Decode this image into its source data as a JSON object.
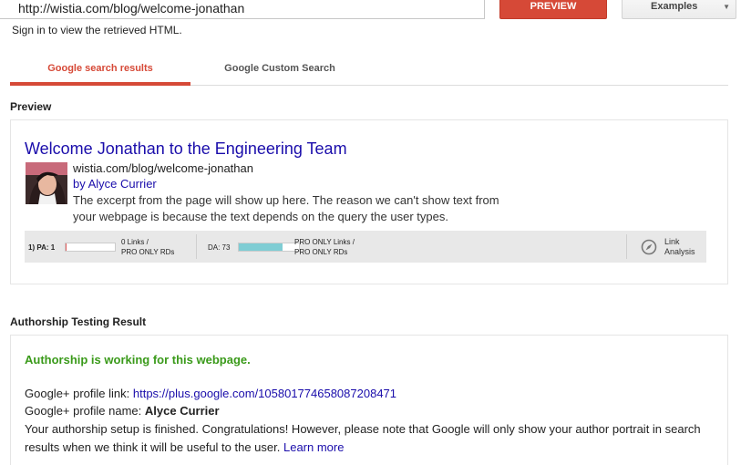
{
  "toolbar": {
    "url_value": "http://wistia.com/blog/welcome-jonathan",
    "preview_label": "PREVIEW",
    "examples_label": "Examples",
    "examples_caret": "▼"
  },
  "signin_note": "Sign in to view the retrieved HTML.",
  "tabs": [
    {
      "label": "Google search results",
      "active": true
    },
    {
      "label": "Google Custom Search",
      "active": false
    }
  ],
  "preview": {
    "heading": "Preview",
    "title": "Welcome Jonathan to the Engineering Team",
    "url": "wistia.com/blog/welcome-jonathan",
    "author": "by Alyce Currier",
    "snippet_line1": "The excerpt from the page will show up here. The reason we can't show text from",
    "snippet_line2": "your webpage is because the text depends on the query the user types."
  },
  "metrics": {
    "rank_pa": "1) PA: 1",
    "pa_fill_fraction": 0.02,
    "links_line1": "0 Links /",
    "links_line2": "PRO ONLY RDs",
    "da": "DA: 73",
    "da_fill_fraction": 0.73,
    "pro_links_line1": "PRO ONLY Links /",
    "pro_links_line2": "PRO ONLY RDs",
    "link_analysis_line1": "Link",
    "link_analysis_line2": "Analysis"
  },
  "authorship": {
    "heading": "Authorship Testing Result",
    "status": "Authorship is working for this webpage.",
    "profile_link_label": "Google+ profile link: ",
    "profile_link_url": "https://plus.google.com/105801774658087208471",
    "profile_name_label": "Google+ profile name: ",
    "profile_name": "Alyce Currier",
    "message": "Your authorship setup is finished. Congratulations! However, please note that Google will only show your author portrait in search results when we think it will be useful to the user. ",
    "learn_more": "Learn more"
  },
  "colors": {
    "accent_red": "#d64937",
    "link_blue": "#1a0dab",
    "success_green": "#3a9a1a",
    "da_bar": "#7fcdd4",
    "pa_bar": "#e15b5b"
  }
}
